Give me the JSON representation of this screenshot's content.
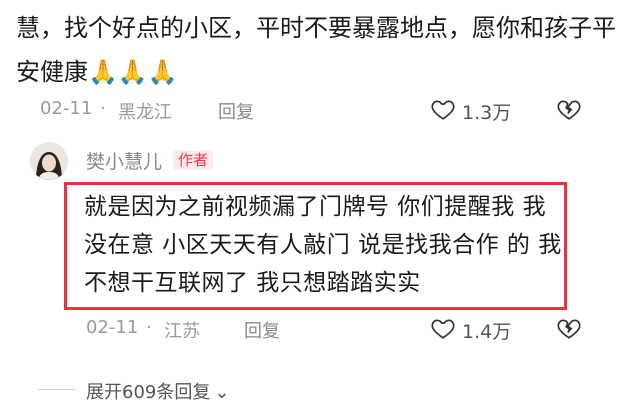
{
  "top_comment": {
    "text": "慧，找个好点的小区，平时不要暴露地点，愿你和孩子平安健康🙏🙏🙏",
    "date": "02-11",
    "location": "黑龙江",
    "reply_label": "回复",
    "likes": "1.3万"
  },
  "author_reply": {
    "username": "樊小慧儿",
    "badge": "作者",
    "text": "就是因为之前视频漏了门牌号 你们提醒我 我没在意 小区天天有人敲门 说是找我合作 的 我不想干互联网了 我只想踏踏实实",
    "date": "02-11",
    "location": "江苏",
    "reply_label": "回复",
    "likes": "1.4万"
  },
  "expand_replies": "展开609条回复",
  "colors": {
    "highlight": "#e8323e",
    "badge_text": "#ee3b4b",
    "badge_bg": "#fdecee"
  }
}
